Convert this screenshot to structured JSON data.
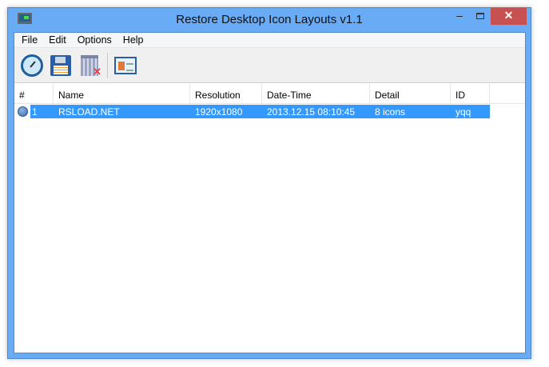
{
  "window": {
    "title": "Restore Desktop Icon Layouts v1.1",
    "minimize": "‒",
    "close": "✕"
  },
  "menu": [
    "File",
    "Edit",
    "Options",
    "Help"
  ],
  "toolbar": [
    "restore-layout",
    "save-layout",
    "delete-layout",
    "properties"
  ],
  "columns": [
    "#",
    "Name",
    "Resolution",
    "Date-Time",
    "Detail",
    "ID"
  ],
  "rows": [
    {
      "num": "1",
      "name": "RSLOAD.NET",
      "resolution": "1920x1080",
      "datetime": "2013.12.15 08:10:45",
      "detail": "8 icons",
      "id": "yqq"
    }
  ]
}
